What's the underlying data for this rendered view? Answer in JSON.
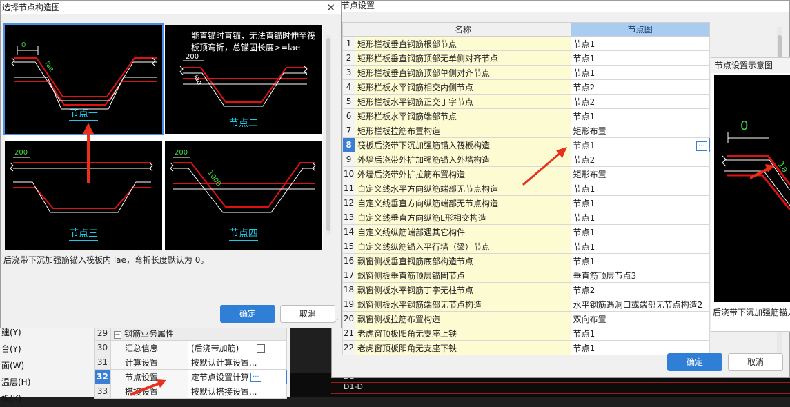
{
  "left_dialog": {
    "title": "选择节点构造图",
    "close_glyph": "✕",
    "note": "能直锚时直锚，无法直锚时伸至筏板顶弯折，总锚固长度>=lae",
    "thumbs": [
      {
        "caption": "节点一",
        "dim": "0",
        "dim2": "lae"
      },
      {
        "caption": "节点二",
        "dim": "200",
        "dim2": "lae"
      },
      {
        "caption": "节点三",
        "dim": "200"
      },
      {
        "caption": "节点四",
        "dim": "200",
        "dim2": "1000"
      }
    ],
    "description": "后浇带下沉加强筋锚入筏板内 lae，弯折长度默认为 0。",
    "ok": "确定",
    "cancel": "取消"
  },
  "right_dialog": {
    "title": "节点设置",
    "columns": [
      "名称",
      "节点图"
    ],
    "rows": [
      {
        "no": "1",
        "name": "矩形栏板垂直钢筋根部节点",
        "value": "节点1"
      },
      {
        "no": "2",
        "name": "矩形栏板垂直钢筋顶部无单侧对齐节点",
        "value": "节点1"
      },
      {
        "no": "3",
        "name": "矩形栏板垂直钢筋顶部单侧对齐节点",
        "value": "节点1"
      },
      {
        "no": "4",
        "name": "矩形栏板水平钢筋相交内侧节点",
        "value": "节点2"
      },
      {
        "no": "5",
        "name": "矩形栏板水平钢筋正交丁字节点",
        "value": "节点2"
      },
      {
        "no": "6",
        "name": "矩形栏板水平钢筋端部节点",
        "value": "节点1"
      },
      {
        "no": "7",
        "name": "矩形栏板拉筋布置构造",
        "value": "矩形布置"
      },
      {
        "no": "8",
        "name": "筏板后浇带下沉加强筋锚入筏板构造",
        "value": "节点1"
      },
      {
        "no": "9",
        "name": "外墙后浇带外扩加强筋锚入外墙构造",
        "value": "节点2"
      },
      {
        "no": "10",
        "name": "外墙后浇带外扩拉筋布置构造",
        "value": "矩形布置"
      },
      {
        "no": "11",
        "name": "自定义线水平方向纵筋端部无节点构造",
        "value": "节点1"
      },
      {
        "no": "12",
        "name": "自定义线垂直方向纵筋端部无节点构造",
        "value": "节点1"
      },
      {
        "no": "13",
        "name": "自定义线垂直方向纵筋L形相交构造",
        "value": "节点1"
      },
      {
        "no": "14",
        "name": "自定义线纵筋端部遇其它构件",
        "value": "节点1"
      },
      {
        "no": "15",
        "name": "自定义线纵筋锚入平行墙（梁）节点",
        "value": "节点1"
      },
      {
        "no": "16",
        "name": "飘窗侧板垂直钢筋底部构造节点",
        "value": "节点1"
      },
      {
        "no": "17",
        "name": "飘窗侧板垂直筋顶层锚固节点",
        "value": "垂直筋顶层节点3"
      },
      {
        "no": "18",
        "name": "飘窗侧板水平钢筋丁字无柱节点",
        "value": "节点2"
      },
      {
        "no": "19",
        "name": "飘窗侧板水平钢筋端部无节点构造",
        "value": "水平钢筋遇洞口或端部无节点构造2"
      },
      {
        "no": "20",
        "name": "飘窗侧板拉筋布置构造",
        "value": "双向布置"
      },
      {
        "no": "21",
        "name": "老虎窗顶板阳角无支座上铁",
        "value": "节点1"
      },
      {
        "no": "22",
        "name": "老虎窗顶板阳角无支座下铁",
        "value": "节点1"
      }
    ],
    "preview_title": "节点设置示意图",
    "preview_dim": "0",
    "preview_dim2": "1a",
    "preview_caption": "后浇带下沉加强筋锚入",
    "ok": "确定",
    "cancel": "取消"
  },
  "bg_left_list": [
    "建(Y)",
    "台(Y)",
    "面(W)",
    "温层(H)",
    "板(K)"
  ],
  "prop_rows": [
    {
      "no": "29",
      "expander": "−",
      "name": "钢筋业务属性",
      "value": ""
    },
    {
      "no": "30",
      "name": "汇总信息",
      "value": "(后浇带加筋)"
    },
    {
      "no": "31",
      "name": "计算设置",
      "value": "按默认计算设置..."
    },
    {
      "no": "32",
      "name": "节点设置",
      "value": "定节点设置计算"
    },
    {
      "no": "33",
      "name": "搭接设置",
      "value": "按默认搭接设置..."
    }
  ],
  "cad_labels": [
    "D1",
    "D1-D"
  ],
  "dots_glyph": "···",
  "colors": {
    "accent": "#2f7fd6",
    "rebar_red": "#e01010",
    "caption_cyan": "#1ec8e8",
    "dim_green": "#3fd43f",
    "arrow_red": "#e8301c"
  }
}
